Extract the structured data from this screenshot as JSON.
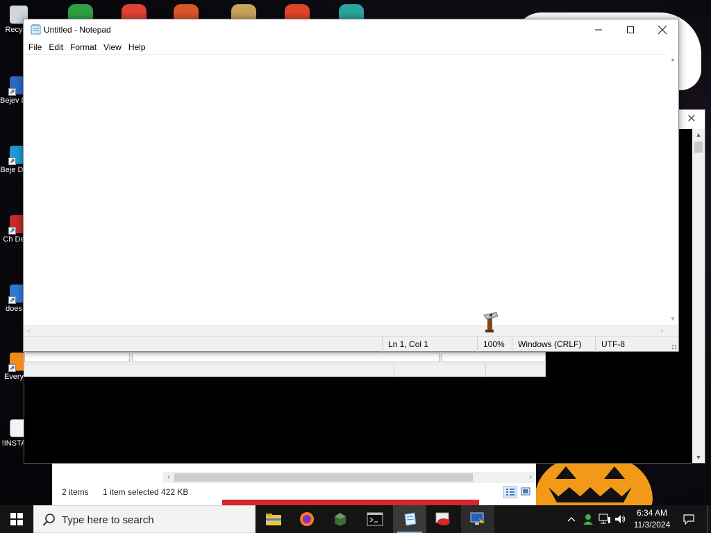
{
  "desktop": {
    "icons": [
      {
        "label": "Recy",
        "icon": "recycle-bin-icon"
      },
      {
        "label": "Bejev De",
        "icon": "bejeweled-icon"
      },
      {
        "label": "Beje De",
        "icon": "bejeweled-icon"
      },
      {
        "label": "Ch De",
        "icon": "chuzzle-icon"
      },
      {
        "label": "does",
        "icon": "shortcut-icon"
      },
      {
        "label": "Every",
        "icon": "everything-icon"
      },
      {
        "label": "!INSTA",
        "icon": "document-icon"
      }
    ]
  },
  "notepad": {
    "title": "Untitled - Notepad",
    "menu": [
      "File",
      "Edit",
      "Format",
      "View",
      "Help"
    ],
    "content": "",
    "status": {
      "position": "Ln 1, Col 1",
      "zoom": "100%",
      "line_ending": "Windows (CRLF)",
      "encoding": "UTF-8"
    }
  },
  "explorer": {
    "item_count": "2 items",
    "selection": "1 item selected  422 KB"
  },
  "taskbar": {
    "search_placeholder": "Type here to search",
    "apps": [
      {
        "name": "file-explorer-icon"
      },
      {
        "name": "firefox-icon"
      },
      {
        "name": "app-green-box-icon"
      },
      {
        "name": "terminal-icon"
      },
      {
        "name": "notepad-icon"
      },
      {
        "name": "red-app-icon"
      },
      {
        "name": "remote-desktop-icon"
      }
    ],
    "time": "6:34 AM",
    "date": "11/3/2024"
  },
  "colors": {
    "accent": "#76b9ed",
    "taskbar": "#141414",
    "pumpkin": "#f29a18"
  }
}
